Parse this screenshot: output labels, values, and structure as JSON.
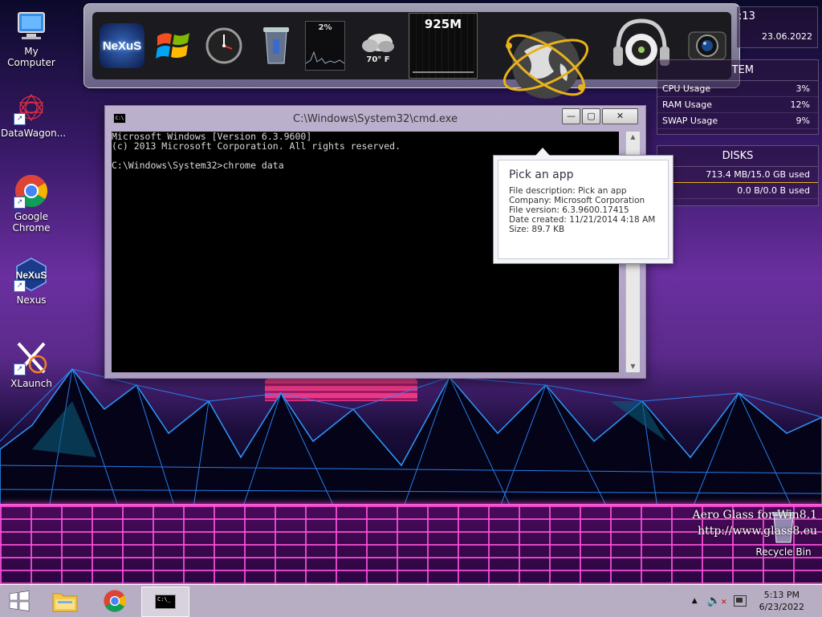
{
  "desktop_icons": [
    {
      "label": "My Computer"
    },
    {
      "label": "DataWagon..."
    },
    {
      "label": "Google Chrome"
    },
    {
      "label": "Nexus"
    },
    {
      "label": "XLaunch"
    }
  ],
  "dock": {
    "cpu_percent": "2%",
    "weather_temp": "70° F",
    "memory": "925M"
  },
  "side_gadgets": {
    "clock_partial": ":13",
    "date": "23.06.2022",
    "system_header": "TEM",
    "system_rows": [
      {
        "label": "CPU Usage",
        "value": "3%"
      },
      {
        "label": "RAM Usage",
        "value": "12%"
      },
      {
        "label": "SWAP Usage",
        "value": "9%"
      }
    ],
    "disks_header": "DISKS",
    "disks_rows": [
      {
        "value": "713.4 MB/15.0 GB used"
      },
      {
        "value": "0.0 B/0.0 B used"
      }
    ]
  },
  "cmd_window": {
    "title": "C:\\Windows\\System32\\cmd.exe",
    "icon_text": "C:\\",
    "minimize": "—",
    "maximize": "▢",
    "close": "✕",
    "lines": [
      "Microsoft Windows [Version 6.3.9600]",
      "(c) 2013 Microsoft Corporation. All rights reserved.",
      "",
      "C:\\Windows\\System32>chrome data"
    ]
  },
  "tooltip": {
    "title": "Pick an app",
    "description": "File description: Pick an app",
    "company": "Company: Microsoft Corporation",
    "version": "File version: 6.3.9600.17415",
    "created": "Date created: 11/21/2014 4:18 AM",
    "size": "Size: 89.7 KB"
  },
  "watermark": {
    "line1": "Aero Glass for Win8.1",
    "line2": "http://www.glass8.eu"
  },
  "recycle_bin": {
    "label": "Recycle Bin"
  },
  "taskbar": {
    "time": "5:13 PM",
    "date": "6/23/2022"
  },
  "colors": {
    "console_bg": "#000000",
    "console_text": "#d8d8d8",
    "grid_accent": "#ff5ad8"
  }
}
